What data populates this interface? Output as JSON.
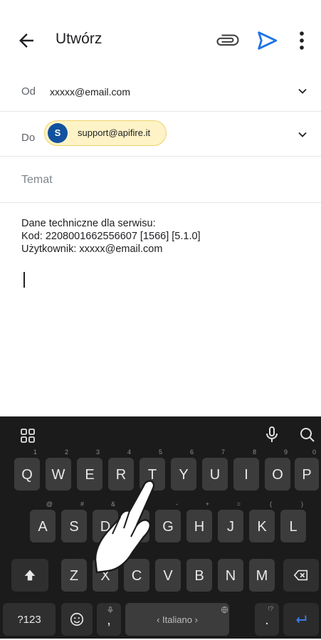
{
  "header": {
    "title": "Utwórz",
    "icons": [
      "back-arrow-icon",
      "paperclip-icon",
      "send-icon",
      "more-vert-icon"
    ],
    "send_color": "#1a73e8"
  },
  "from": {
    "label": "Od",
    "value": "xxxxx@email.com"
  },
  "to": {
    "label": "Do",
    "chip_initial": "S",
    "chip_address": "support@apifire.it",
    "chip_color": "#11519f"
  },
  "subject": {
    "placeholder": "Temat"
  },
  "body": {
    "lines": [
      "Dane techniczne dla serwisu:",
      "Kod: 2208001662556607 [1566] [5.1.0]",
      "Użytkownik: xxxxx@email.com"
    ]
  },
  "keyboard": {
    "row1": [
      {
        "k": "Q",
        "h": "1"
      },
      {
        "k": "W",
        "h": "2"
      },
      {
        "k": "E",
        "h": "3"
      },
      {
        "k": "R",
        "h": "4"
      },
      {
        "k": "T",
        "h": "5"
      },
      {
        "k": "Y",
        "h": "6"
      },
      {
        "k": "U",
        "h": "7"
      },
      {
        "k": "I",
        "h": "8"
      },
      {
        "k": "O",
        "h": "9"
      },
      {
        "k": "P",
        "h": "0"
      }
    ],
    "row2": [
      {
        "k": "A",
        "h": "@"
      },
      {
        "k": "S",
        "h": "#"
      },
      {
        "k": "D",
        "h": "&"
      },
      {
        "k": "F",
        "h": "*"
      },
      {
        "k": "G",
        "h": "-"
      },
      {
        "k": "H",
        "h": "+"
      },
      {
        "k": "J",
        "h": "="
      },
      {
        "k": "K",
        "h": "("
      },
      {
        "k": "L",
        "h": ")"
      }
    ],
    "row3": [
      {
        "k": "Z",
        "h": ""
      },
      {
        "k": "X",
        "h": ""
      },
      {
        "k": "C",
        "h": ""
      },
      {
        "k": "V",
        "h": ""
      },
      {
        "k": "B",
        "h": ""
      },
      {
        "k": "N",
        "h": ""
      },
      {
        "k": "M",
        "h": ""
      }
    ],
    "sym_label": "?123",
    "comma": ",",
    "space_label": "‹ Italiano ›",
    "period": ".",
    "period_hint": "!?"
  }
}
